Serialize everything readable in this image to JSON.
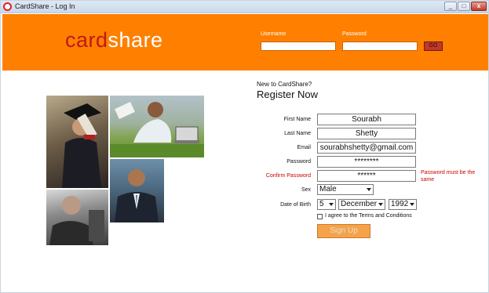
{
  "window": {
    "title": "CardShare - Log In",
    "minimize_glyph": "_",
    "maximize_glyph": "□",
    "close_glyph": "x"
  },
  "header": {
    "logo_part1": "card",
    "logo_part2": "share",
    "username_label": "Username",
    "password_label": "Password",
    "username_value": "",
    "password_value": "",
    "go_label": "GO",
    "bg_color": "#ff8000"
  },
  "register": {
    "new_to": "New to CardShare?",
    "title": "Register Now",
    "first_name_label": "First Name",
    "first_name_value": "Sourabh",
    "last_name_label": "Last Name",
    "last_name_value": "Shetty",
    "email_label": "Email",
    "email_value": "sourabhshetty@gmail.com",
    "password_label": "Password",
    "password_value": "********",
    "confirm_label": "Confirm Password",
    "confirm_value": "******",
    "confirm_error": "Password must be the same",
    "sex_label": "Sex",
    "sex_value": "Male",
    "dob_label": "Date of Birth",
    "dob_day": "5",
    "dob_month": "December",
    "dob_year": "1992",
    "terms_label": "I agree to the Terms and Conditions",
    "signup_label": "Sign Up"
  },
  "colors": {
    "accent": "#ff8000",
    "logo_red": "#c0181a",
    "error_red": "#cc0000",
    "signup_bg": "#f5a24a"
  }
}
